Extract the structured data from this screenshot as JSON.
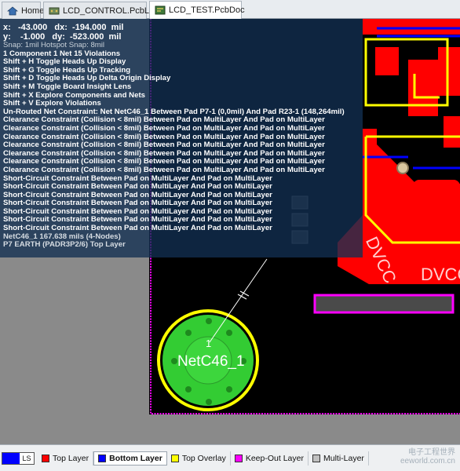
{
  "tabs": [
    {
      "label": "Home",
      "icon": "home-icon"
    },
    {
      "label": "LCD_CONTROL.PcbLib",
      "icon": "pcblib-icon"
    },
    {
      "label": "LCD_TEST.PcbDoc",
      "icon": "pcbdoc-icon"
    }
  ],
  "hud": {
    "coord_line1": "x:   -43.000   dx:  -194.000  mil",
    "coord_line2": "y:    -1.000   dy:  -523.000  mil",
    "snap": "Snap: 1mil Hotspot Snap: 8mil",
    "summary": "1 Component 1 Net 15 Violations",
    "shortcuts": [
      "Shift + H   Toggle Heads Up Display",
      "Shift + G   Toggle Heads Up Tracking",
      "Shift + D   Toggle Heads Up Delta Origin Display",
      "Shift + M   Toggle Board Insight Lens",
      "Shift + X   Explore Components and Nets",
      "Shift + V   Explore Violations"
    ],
    "violations": [
      "Un-Routed Net Constraint: Net NetC46_1 Between Pad P7-1 (0,0mil) And Pad R23-1 (148,264mil)",
      "Clearance Constraint (Collision < 8mil)  Between Pad on MultiLayer And Pad on MultiLayer",
      "Clearance Constraint (Collision < 8mil)  Between Pad on MultiLayer And Pad on MultiLayer",
      "Clearance Constraint (Collision < 8mil)  Between Pad on MultiLayer And Pad on MultiLayer",
      "Clearance Constraint (Collision < 8mil)  Between Pad on MultiLayer And Pad on MultiLayer",
      "Clearance Constraint (Collision < 8mil)  Between Pad on MultiLayer And Pad on MultiLayer",
      "Clearance Constraint (Collision < 8mil)  Between Pad on MultiLayer And Pad on MultiLayer",
      "Clearance Constraint (Collision < 8mil)  Between Pad on MultiLayer And Pad on MultiLayer",
      "Short-Circuit Constraint Between Pad on MultiLayer And Pad on MultiLayer",
      "Short-Circuit Constraint Between Pad on MultiLayer And Pad on MultiLayer",
      "Short-Circuit Constraint Between Pad on MultiLayer And Pad on MultiLayer",
      "Short-Circuit Constraint Between Pad on MultiLayer And Pad on MultiLayer",
      "Short-Circuit Constraint Between Pad on MultiLayer And Pad on MultiLayer",
      "Short-Circuit Constraint Between Pad on MultiLayer And Pad on MultiLayer",
      "Short-Circuit Constraint Between Pad on MultiLayer And Pad on MultiLayer"
    ],
    "net_info": "NetC46_1     167.638 mils  (4-Nodes)",
    "pad_info": "P7  EARTH (PADR3P2/6)  Top Layer"
  },
  "board": {
    "pad_label": "1",
    "net_label": "NetC46_1",
    "dvcc_label_1": "DVCC",
    "dvcc_label_2": "DVCC",
    "colors": {
      "top_layer": "#ff0000",
      "bottom_layer": "#0000ff",
      "top_overlay": "#ffff00",
      "keep_out": "#ff00ff",
      "multi_layer": "#c0c0c0",
      "board_bg": "#000000",
      "pad_fill": "#33cc33"
    }
  },
  "layers": {
    "ls_label": "LS",
    "items": [
      {
        "label": "Top Layer",
        "color": "#ff0000"
      },
      {
        "label": "Bottom Layer",
        "color": "#0000ff"
      },
      {
        "label": "Top Overlay",
        "color": "#ffff00"
      },
      {
        "label": "Keep-Out Layer",
        "color": "#ff00ff"
      },
      {
        "label": "Multi-Layer",
        "color": "#c0c0c0"
      }
    ],
    "watermark_1": "电子工程世界",
    "watermark_2": "eeworld.com.cn"
  }
}
